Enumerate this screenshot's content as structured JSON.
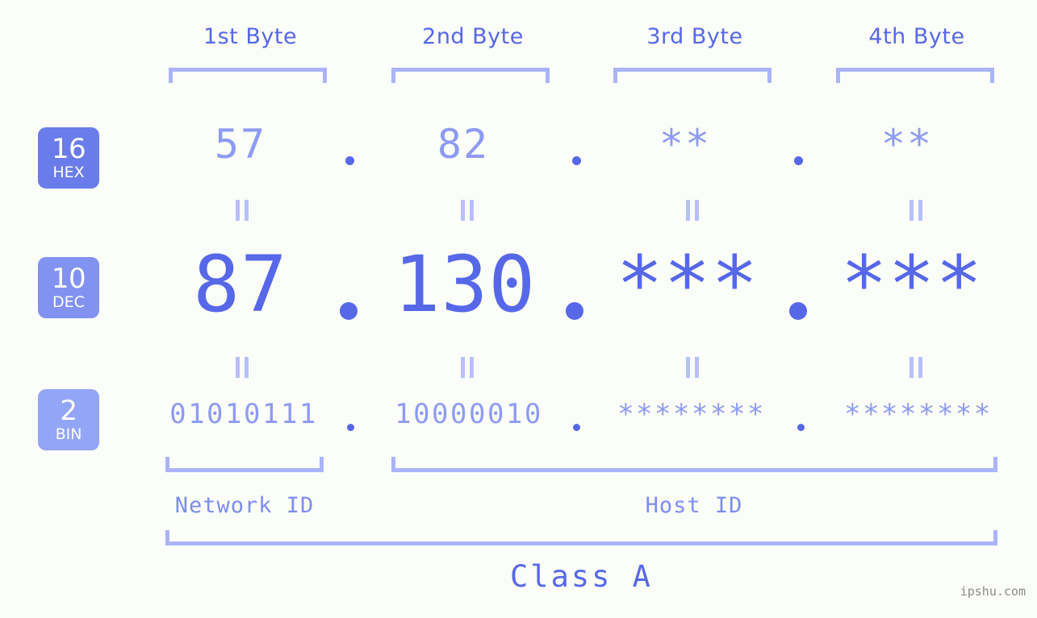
{
  "meta": {
    "background_color": "#fbfdf8",
    "accent_strong": "#5668e8",
    "accent_light": "#8d9bf2",
    "accent_bracket": "#aab4fb",
    "watermark": "ipshu.com"
  },
  "columns": [
    {
      "header": "1st Byte",
      "hex": "57",
      "dec": "87",
      "bin": "01010111"
    },
    {
      "header": "2nd Byte",
      "hex": "82",
      "dec": "130",
      "bin": "10000010"
    },
    {
      "header": "3rd Byte",
      "hex": "**",
      "dec": "***",
      "bin": "********"
    },
    {
      "header": "4th Byte",
      "hex": "**",
      "dec": "***",
      "bin": "********"
    }
  ],
  "bases": [
    {
      "number": "16",
      "name": "HEX",
      "color": "#6a7ce9"
    },
    {
      "number": "10",
      "name": "DEC",
      "color": "#8292f0"
    },
    {
      "number": "2",
      "name": "BIN",
      "color": "#93a5f6"
    }
  ],
  "separators": {
    "dot": "."
  },
  "equality_marks": {
    "glyph": "equals-rotated"
  },
  "sections": [
    {
      "label": "Network ID"
    },
    {
      "label": "Host ID"
    }
  ],
  "class": {
    "label": "Class A"
  },
  "ip": {
    "hex": "57.82.**.**",
    "dec": "87.130.***.***",
    "bin": "01010111.10000010.********.********"
  }
}
